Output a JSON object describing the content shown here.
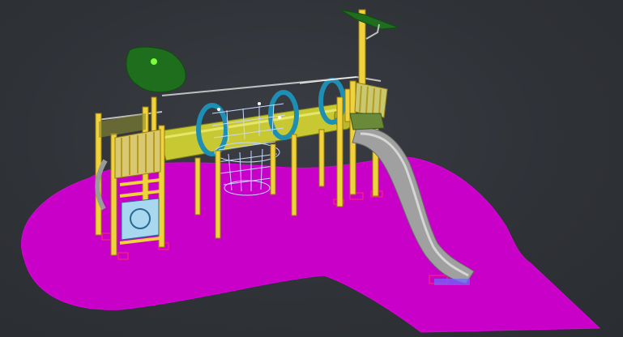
{
  "viewport": {
    "background_color": "#2f3237"
  },
  "model": {
    "surface_color": "#c800c8",
    "timber_color": "#f0d23c",
    "tube_color": "#c8c832",
    "ring_color": "#1e8fb4",
    "slide_color": "#a0a0a0",
    "roof_color": "#1e6e1e",
    "net_color": "#c8d8ff",
    "icon": "playground-3d-model-icon"
  }
}
